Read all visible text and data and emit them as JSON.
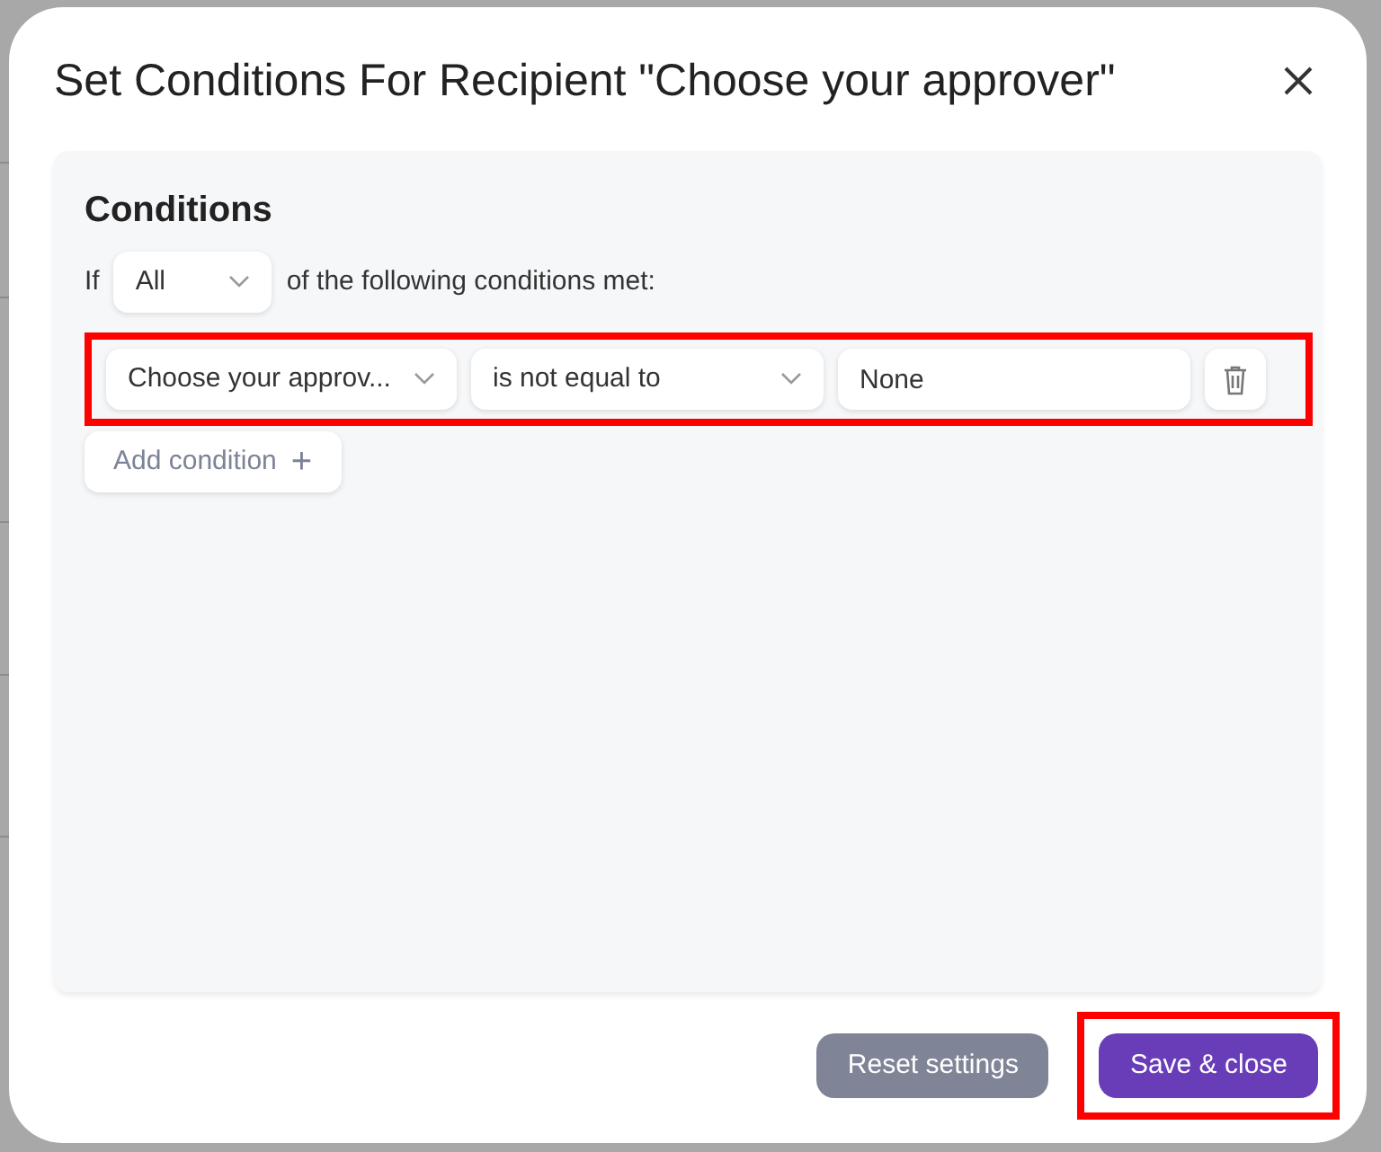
{
  "dialog": {
    "title": "Set Conditions For Recipient \"Choose your approver\""
  },
  "panel": {
    "heading": "Conditions",
    "prefix": "If",
    "match": {
      "value": "All"
    },
    "suffix": "of the following conditions met:",
    "conditions": [
      {
        "field": "Choose your approv...",
        "operator": "is not equal to",
        "value": "None",
        "highlighted": true
      }
    ],
    "add_button": "Add condition",
    "add_symbol": "+"
  },
  "footer": {
    "buttons": [
      {
        "label": "Reset settings",
        "kind": "secondary",
        "highlighted": false
      },
      {
        "label": "Save & close",
        "kind": "primary",
        "highlighted": true
      }
    ]
  }
}
